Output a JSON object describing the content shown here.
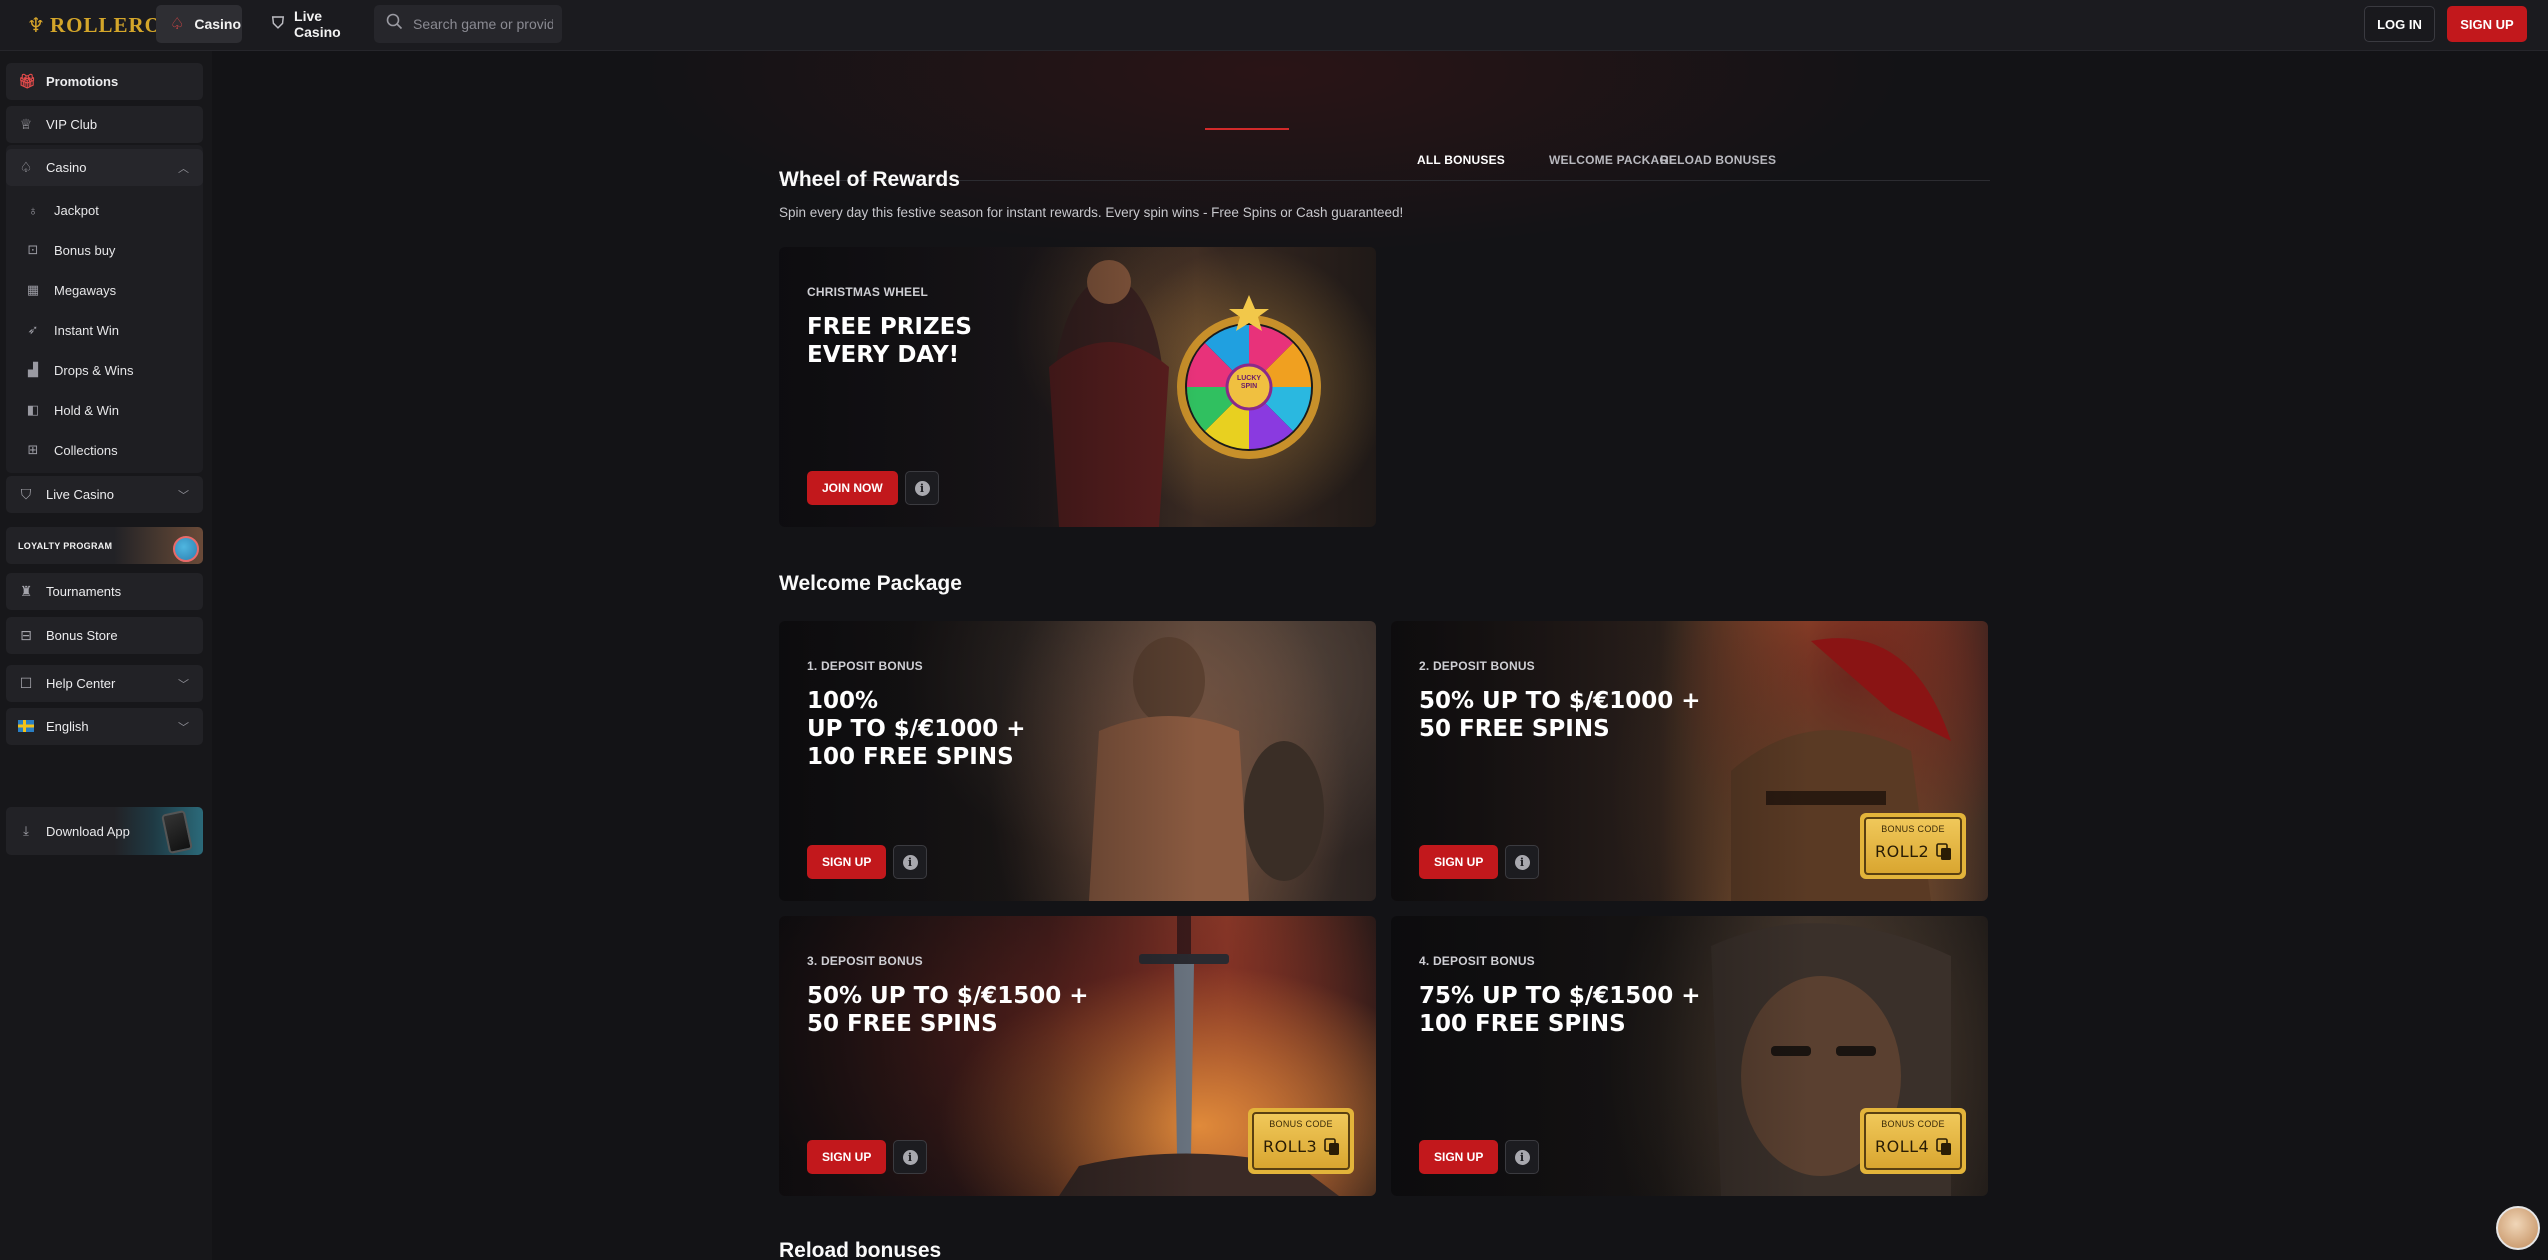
{
  "brand": {
    "name": "ROLLERO",
    "accent": "#c2181c",
    "gold": "#d4a62a"
  },
  "header": {
    "nav": [
      {
        "label": "Casino",
        "icon": "spade-icon",
        "active": true
      },
      {
        "label": "Live Casino",
        "icon": "dealer-icon",
        "active": false
      }
    ],
    "search": {
      "placeholder": "Search game or provider",
      "value": ""
    },
    "login_label": "LOG IN",
    "signup_label": "SIGN UP"
  },
  "sidebar": {
    "promotions": "Promotions",
    "vip": "VIP Club",
    "casino": "Casino",
    "casino_sub": [
      "Jackpot",
      "Bonus buy",
      "Megaways",
      "Instant Win",
      "Drops & Wins",
      "Hold & Win",
      "Collections"
    ],
    "live_casino": "Live Casino",
    "loyalty": "LOYALTY PROGRAM",
    "tournaments": "Tournaments",
    "bonus_store": "Bonus Store",
    "help_center": "Help Center",
    "language": "English",
    "download": "Download App"
  },
  "tabs": [
    "ALL BONUSES",
    "WELCOME PACKAGE",
    "RELOAD BONUSES"
  ],
  "active_tab": "ALL BONUSES",
  "wheel": {
    "title": "Wheel of Rewards",
    "subtitle": "Spin every day this festive season for instant rewards. Every spin wins - Free Spins or Cash guaranteed!",
    "card": {
      "label": "CHRISTMAS WHEEL",
      "headline": "FREE PRIZES\nEVERY DAY!",
      "cta": "JOIN NOW",
      "wheel_text": "LUCKY SPIN"
    }
  },
  "welcome": {
    "title": "Welcome Package",
    "cards": [
      {
        "label": "1. DEPOSIT BONUS",
        "headline": "100%\nUP TO $/€1000 +\n100 FREE SPINS",
        "cta": "SIGN UP",
        "bonus_code": null
      },
      {
        "label": "2. DEPOSIT BONUS",
        "headline": "50% UP TO $/€1000 +\n50 FREE SPINS",
        "cta": "SIGN UP",
        "bonus_code_label": "BONUS CODE",
        "bonus_code": "ROLL2"
      },
      {
        "label": "3. DEPOSIT BONUS",
        "headline": "50% UP TO $/€1500 +\n50 FREE SPINS",
        "cta": "SIGN UP",
        "bonus_code_label": "BONUS CODE",
        "bonus_code": "ROLL3"
      },
      {
        "label": "4. DEPOSIT BONUS",
        "headline": "75% UP TO $/€1500 +\n100 FREE SPINS",
        "cta": "SIGN UP",
        "bonus_code_label": "BONUS CODE",
        "bonus_code": "ROLL4"
      }
    ]
  },
  "reload": {
    "title": "Reload bonuses"
  }
}
